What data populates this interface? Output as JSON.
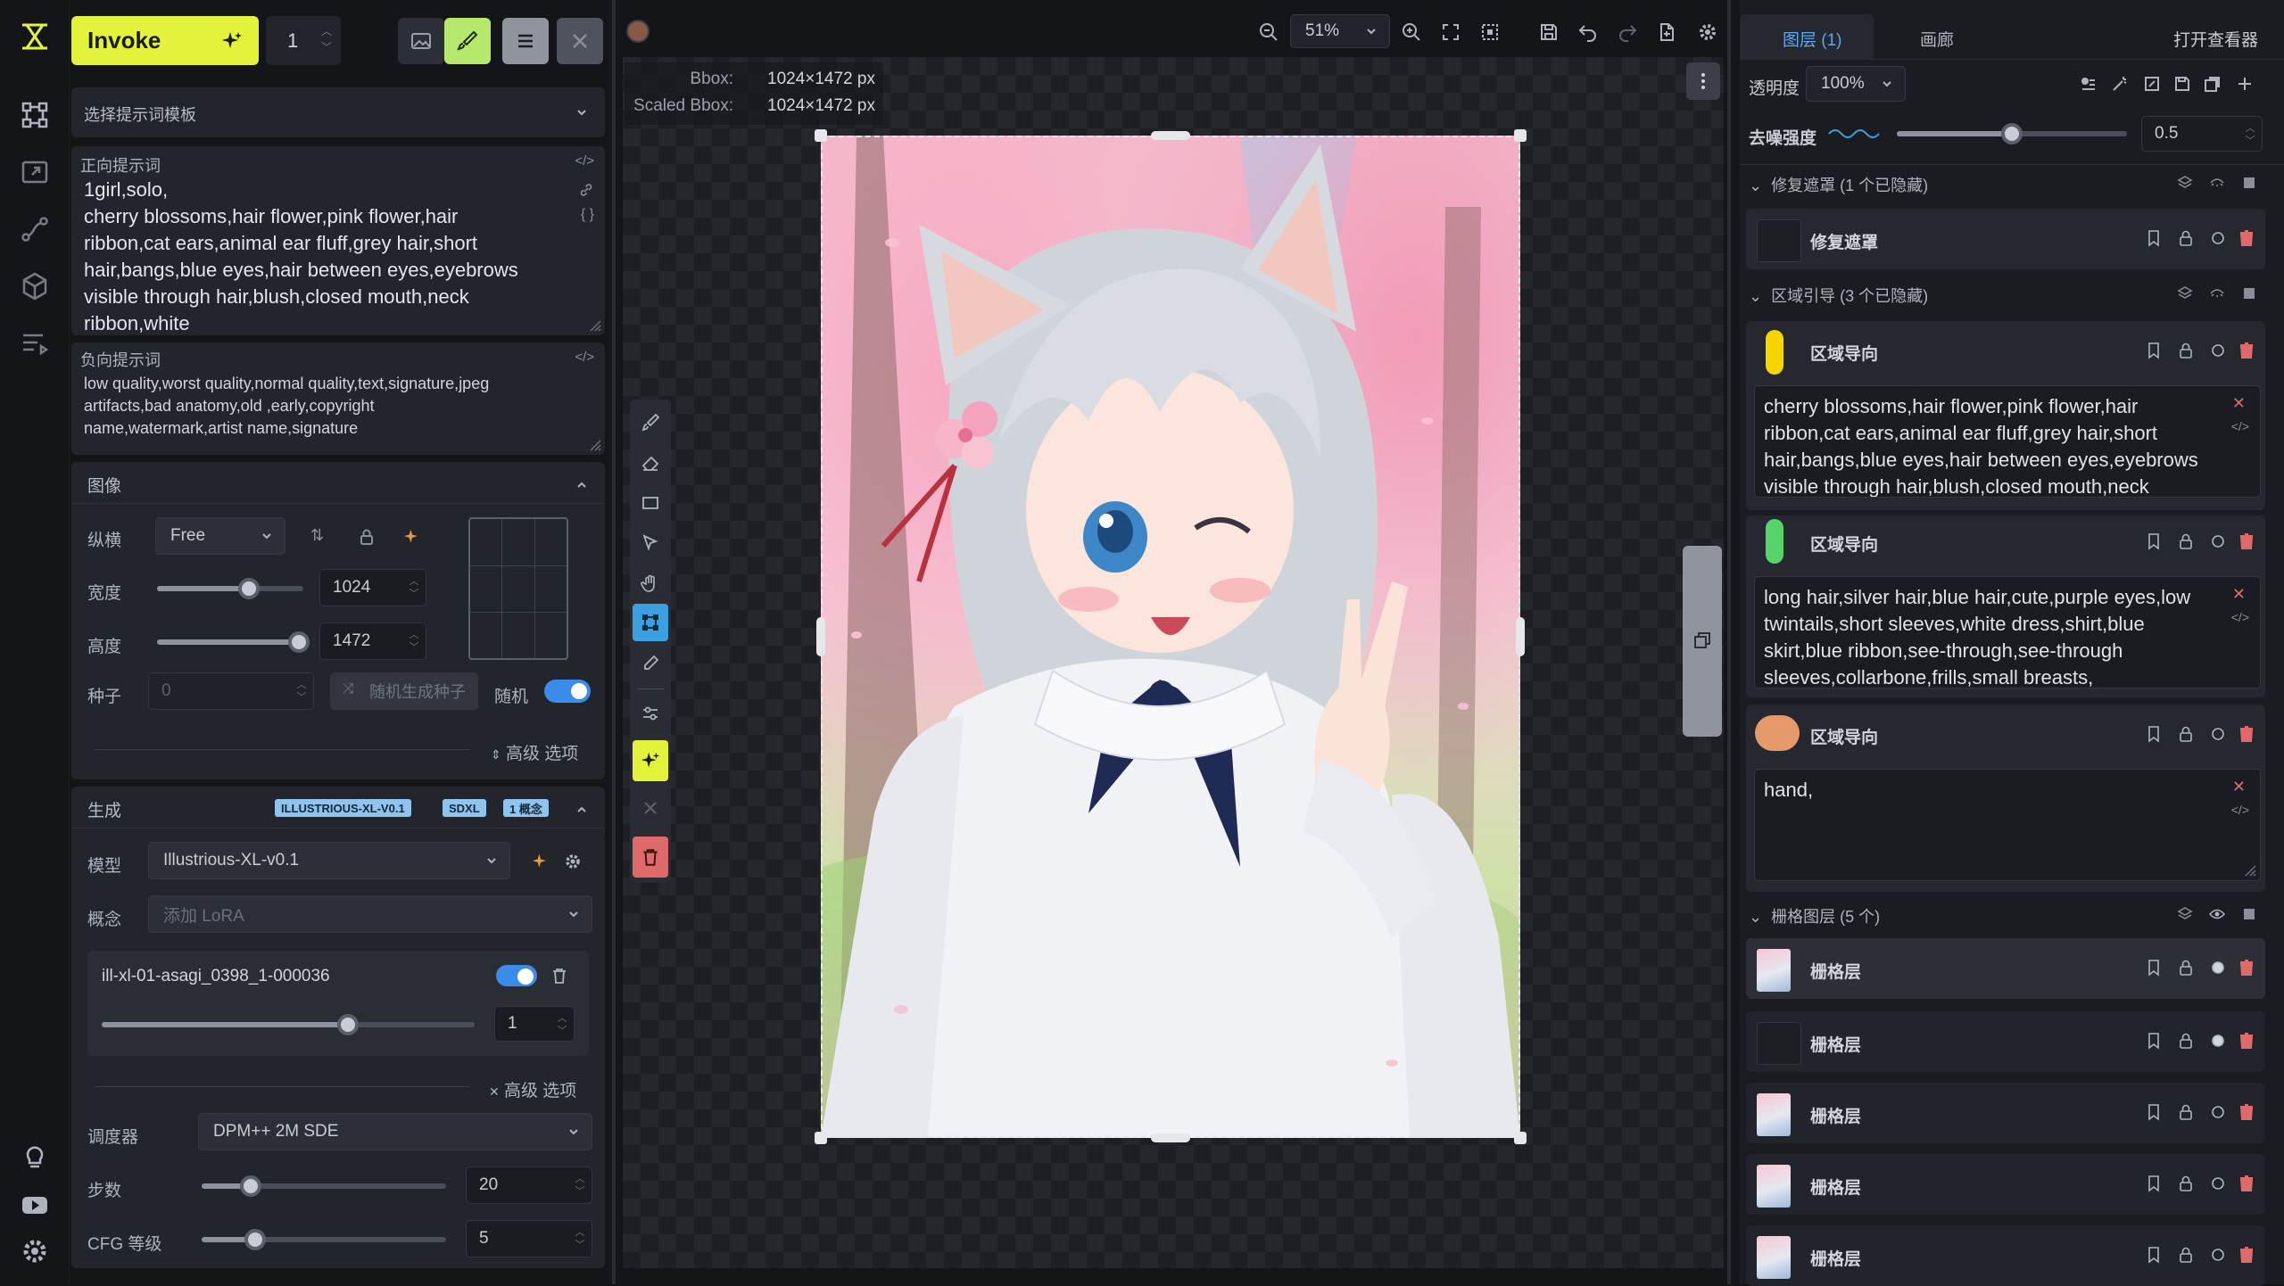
{
  "toolbar": {
    "invoke_label": "Invoke",
    "count": "1",
    "zoom": "51%"
  },
  "canvas": {
    "bbox_label": "Bbox:",
    "bbox_value": "1024×1472 px",
    "scaled_label": "Scaled Bbox:",
    "scaled_value": "1024×1472 px"
  },
  "left": {
    "template_select": "选择提示词模板",
    "pos_prompt_label": "正向提示词",
    "pos_prompt_lines": [
      "1girl,solo,",
      "cherry blossoms,hair flower,pink flower,hair",
      "ribbon,cat ears,animal ear fluff,grey hair,short",
      "hair,bangs,blue eyes,hair between eyes,eyebrows",
      "visible through hair,blush,closed mouth,neck",
      "ribbon,white"
    ],
    "neg_prompt_label": "负向提示词",
    "neg_prompt_lines": [
      "low quality,worst quality,normal quality,text,signature,jpeg",
      "artifacts,bad anatomy,old ,early,copyright",
      "name,watermark,artist name,signature"
    ],
    "image_section": "图像",
    "aspect_label": "纵横",
    "aspect_value": "Free",
    "width_label": "宽度",
    "width_value": "1024",
    "width_frac": 0.63,
    "height_label": "高度",
    "height_value": "1472",
    "height_frac": 0.97,
    "seed_label": "种子",
    "seed_value": "0",
    "random_seed_btn": "随机生成种子",
    "random_label": "随机",
    "advanced_1": "高级 选项",
    "gen_section": "生成",
    "badges": [
      "ILLUSTRIOUS-XL-V0.1",
      "SDXL",
      "1 概念"
    ],
    "model_label": "模型",
    "model_value": "Illustrious-XL-v0.1",
    "concept_label": "概念",
    "concept_placeholder": "添加 LoRA",
    "lora_name": "ill-xl-01-asagi_0398_1-000036",
    "lora_weight": "1",
    "lora_frac": 0.66,
    "advanced_2": "高级 选项",
    "scheduler_label": "调度器",
    "scheduler_value": "DPM++ 2M SDE",
    "steps_label": "步数",
    "steps_value": "20",
    "steps_frac": 0.2,
    "cfg_label": "CFG 等级",
    "cfg_value": "5",
    "cfg_frac": 0.22
  },
  "right": {
    "tab_layers": "图层 (1)",
    "tab_gallery": "画廊",
    "open_viewer": "打开查看器",
    "opacity_label": "透明度",
    "opacity_value": "100%",
    "denoise_label": "去噪强度",
    "denoise_value": "0.5",
    "denoise_frac": 0.5,
    "group_inpaint": "修复遮罩 (1 个已隐藏)",
    "inpaint_layer": "修复遮罩",
    "group_regional": "区域引导 (3 个已隐藏)",
    "regional_layers": [
      {
        "name": "区域导向",
        "color": "#f5d400",
        "lines": [
          "cherry blossoms,hair flower,pink flower,hair",
          "ribbon,cat ears,animal ear fluff,grey hair,short",
          "hair,bangs,blue eyes,hair between eyes,eyebrows",
          "visible through hair,blush,closed mouth,neck"
        ]
      },
      {
        "name": "区域导向",
        "color": "#57d36b",
        "lines": [
          "long hair,silver hair,blue hair,cute,purple eyes,low",
          "twintails,short sleeves,white dress,shirt,blue",
          "skirt,blue ribbon,see-through,see-through",
          "sleeves,collarbone,frills,small breasts,"
        ]
      },
      {
        "name": "区域导向",
        "color": "#e59a6c",
        "lines": [
          "hand,"
        ]
      }
    ],
    "group_raster": "栅格图层 (5 个)",
    "raster_layers": [
      "栅格层",
      "栅格层",
      "栅格层",
      "栅格层",
      "栅格层"
    ]
  }
}
